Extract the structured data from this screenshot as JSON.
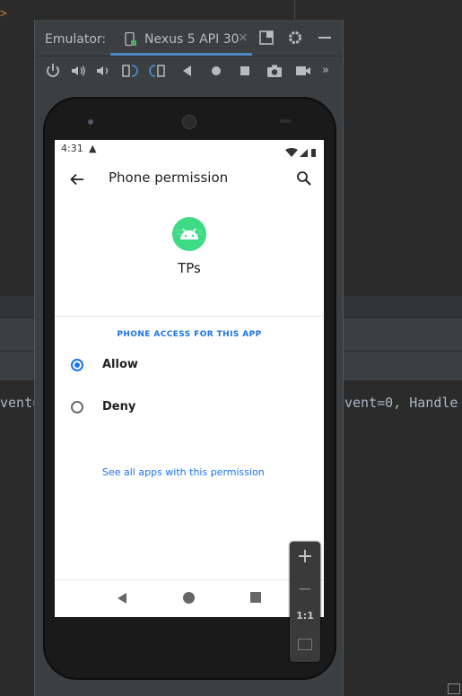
{
  "ide": {
    "caret": ">",
    "code_left": "vent=",
    "code_right": "vent=0, Handle"
  },
  "emulator": {
    "label": "Emulator:",
    "tab_label": "Nexus 5 API 30",
    "tab_close": "×"
  },
  "device": {
    "status_time": "4:31",
    "status_warning": "▲",
    "page_title": "Phone permission",
    "app_name": "TPs",
    "section_header": "PHONE ACCESS FOR THIS APP",
    "options": [
      {
        "label": "Allow",
        "selected": true
      },
      {
        "label": "Deny",
        "selected": false
      }
    ],
    "see_all_link": "See all apps with this permission"
  },
  "zoom": {
    "zoom_in": "+",
    "zoom_out": "−",
    "one_to_one": "1:1"
  },
  "colors": {
    "accent": "#1a73e8",
    "android_green": "#3ddc84",
    "ide_bg": "#2b2b2b",
    "emulator_bg": "#3c3f41"
  }
}
